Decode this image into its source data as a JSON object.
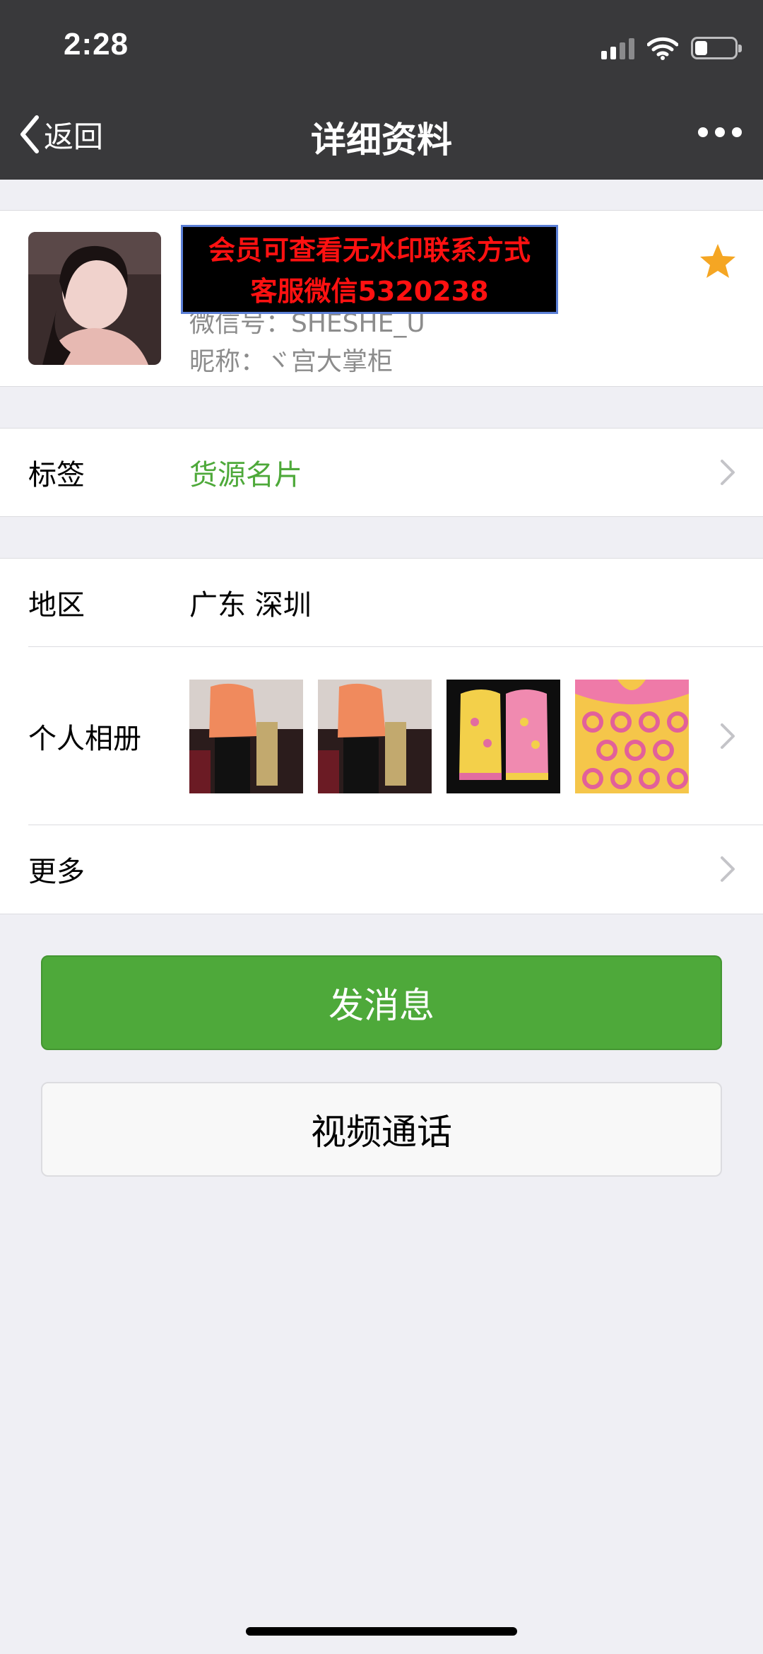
{
  "status_bar": {
    "time": "2:28"
  },
  "nav": {
    "back_label": "返回",
    "title": "详细资料"
  },
  "profile": {
    "watermark_line1": "会员可查看无水印联系方式",
    "watermark_line2": "客服微信5320238",
    "wechat_id_partial": "微信号：SHESHE_U",
    "nickname": "昵称：ヾ宫大掌柜"
  },
  "rows": {
    "tag": {
      "label": "标签",
      "value": "货源名片"
    },
    "region": {
      "label": "地区",
      "value": "广东 深圳"
    },
    "album": {
      "label": "个人相册"
    },
    "more": {
      "label": "更多"
    }
  },
  "buttons": {
    "send_message": "发消息",
    "video_call": "视频通话"
  },
  "colors": {
    "nav_bg": "#39393b",
    "accent_green": "#4ea93a",
    "tag_green": "#4ea93a",
    "star": "#f5a623"
  }
}
